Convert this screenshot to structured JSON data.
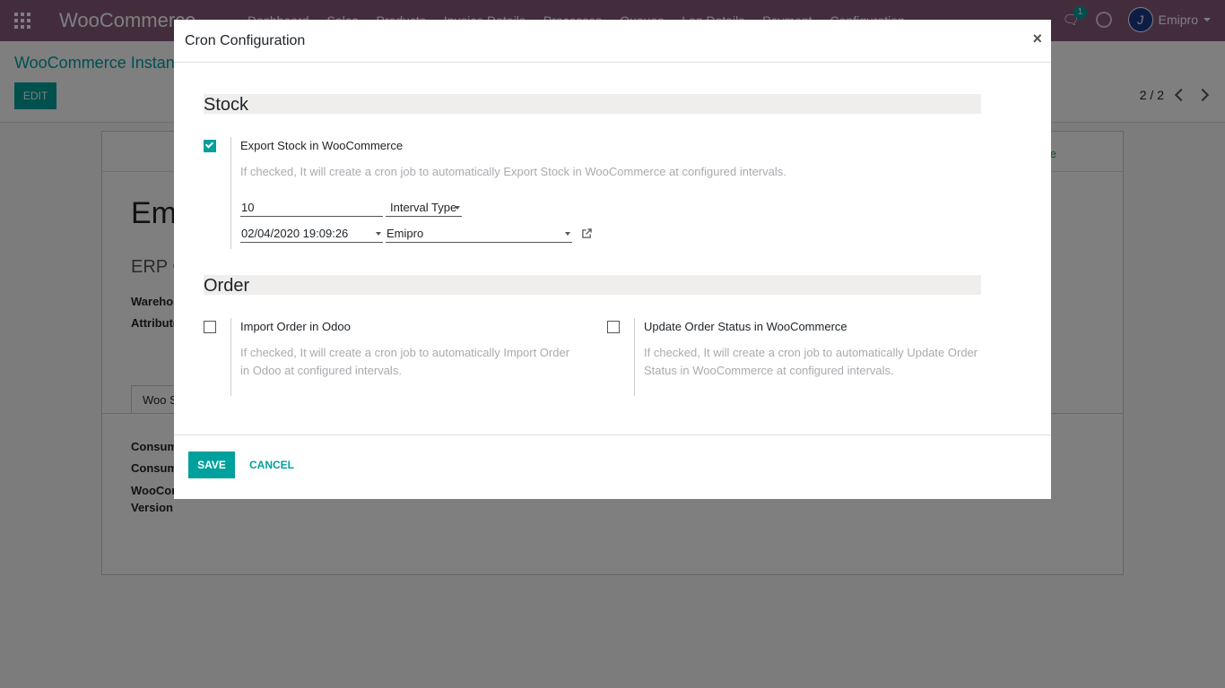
{
  "navbar": {
    "brand": "WooCommerce",
    "menu": [
      "Dashboard",
      "Sales",
      "Products",
      "Invoice Details",
      "Processes",
      "Queues",
      "Log Details",
      "Payment",
      "Configuration"
    ],
    "chat_badge": "1",
    "user": "Emipro",
    "avatar_initial": "J"
  },
  "control_panel": {
    "breadcrumb": "WooCommerce Instan",
    "edit_label": "EDIT",
    "pager": "2 / 2"
  },
  "sheet": {
    "status": "tive",
    "name": "Emi",
    "erp": "ERP C",
    "labels": {
      "warehouse": "Wareho",
      "attribute": "Attribute",
      "consumer1": "Consum",
      "consumer2": "Consum",
      "woo": "WooCom",
      "version": "Version"
    },
    "tab": "Woo S"
  },
  "modal": {
    "title": "Cron Configuration",
    "close": "×",
    "stock": {
      "section": "Stock",
      "export_label": "Export Stock in WooCommerce",
      "export_help": "If checked, It will create a cron job to automatically Export Stock in WooCommerce at configured intervals.",
      "interval_number": "10",
      "interval_type": "Interval Type",
      "next_call": "02/04/2020 19:09:26",
      "user": "Emipro"
    },
    "order": {
      "section": "Order",
      "import_label": "Import Order in Odoo",
      "import_help_1": "If checked, It will create a cron job to automatically Import Order",
      "import_help_2": "in Odoo at configured intervals.",
      "update_label": "Update Order Status in WooCommerce",
      "update_help_1": "If checked, It will create a cron job to automatically Update Order",
      "update_help_2": "Status in WooCommerce at configured intervals."
    },
    "save_label": "SAVE",
    "cancel_label": "CANCEL"
  },
  "colors": {
    "navbar": "#875a7b",
    "accent": "#00a09d",
    "section_bg": "#efeeed"
  }
}
